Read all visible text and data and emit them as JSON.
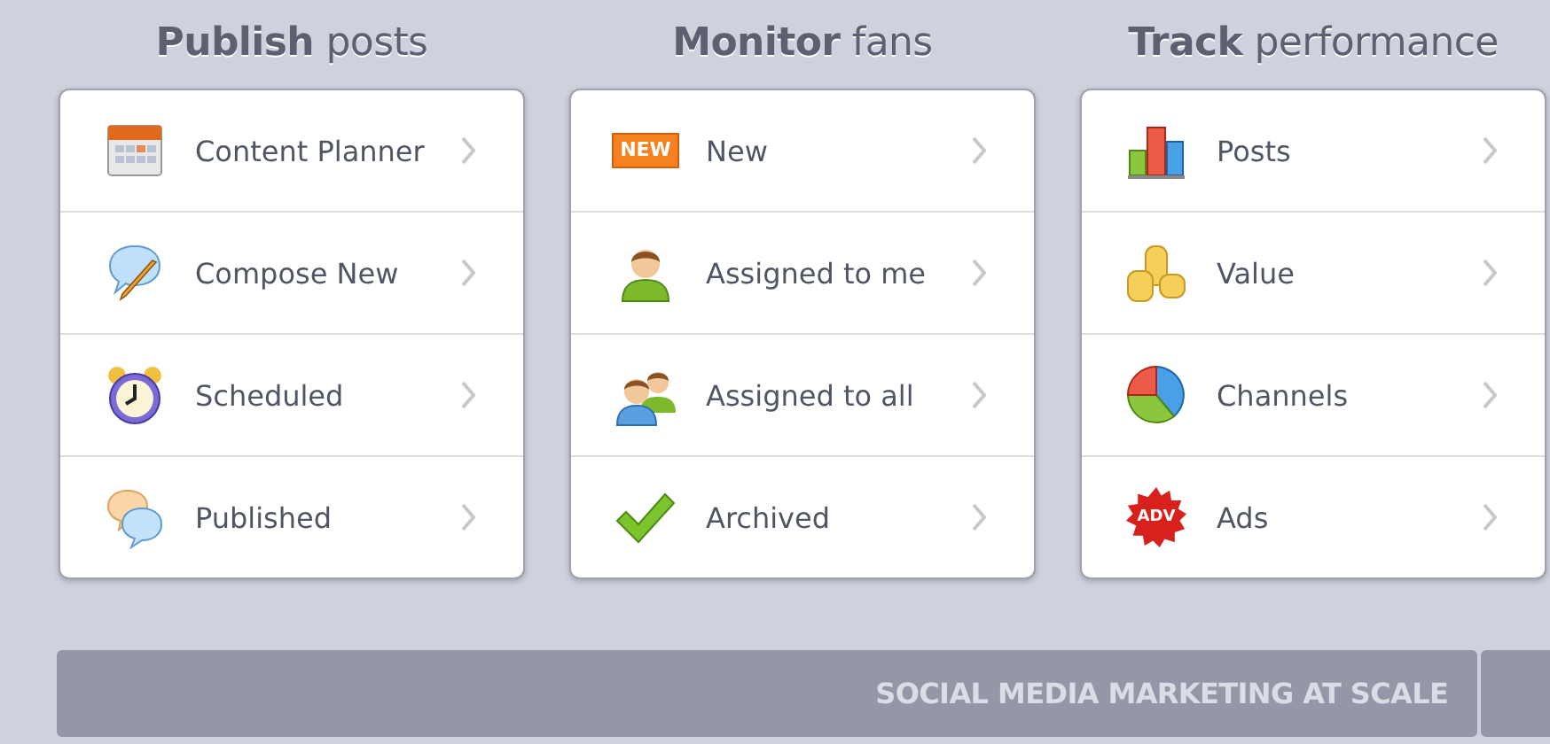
{
  "sections": [
    {
      "heading": "**Publish** posts",
      "items": [
        {
          "label": "Content Planner"
        },
        {
          "label": "Compose New"
        },
        {
          "label": "Scheduled"
        },
        {
          "label": "Published"
        }
      ]
    },
    {
      "heading": "**Monitor** fans",
      "items": [
        {
          "label": "New",
          "badge": "NEW"
        },
        {
          "label": "Assigned to me"
        },
        {
          "label": "Assigned to all"
        },
        {
          "label": "Archived"
        }
      ]
    },
    {
      "heading": "**Track** performance",
      "items": [
        {
          "label": "Posts"
        },
        {
          "label": "Value"
        },
        {
          "label": "Channels"
        },
        {
          "label": "Ads",
          "badge": "ADV"
        }
      ]
    }
  ],
  "banner": {
    "text": "SOCIAL MEDIA MARKETING AT SCALE"
  }
}
